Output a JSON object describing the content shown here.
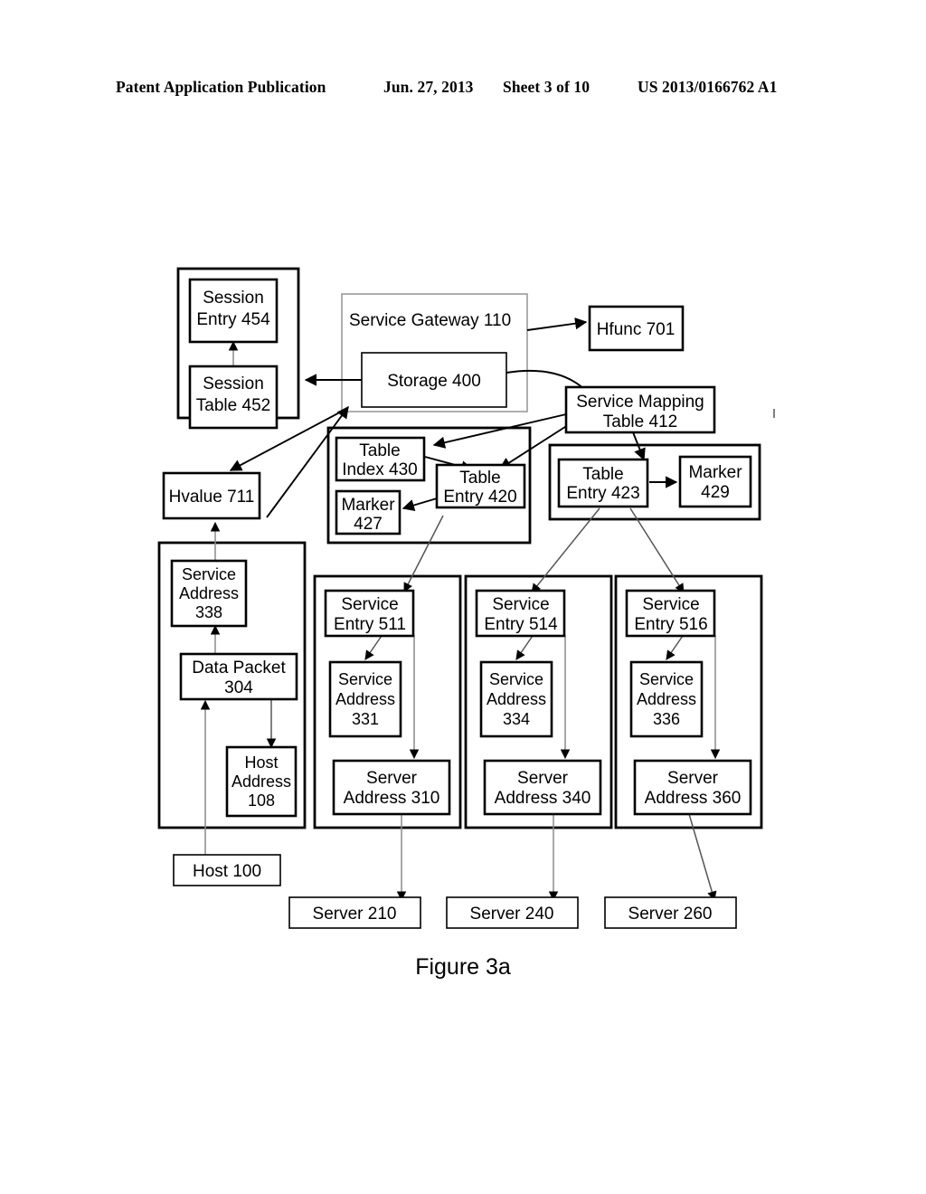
{
  "header": {
    "publication": "Patent Application Publication",
    "date": "Jun. 27, 2013",
    "sheet": "Sheet 3 of 10",
    "number": "US 2013/0166762 A1"
  },
  "figure": {
    "caption": "Figure 3a"
  },
  "diagram": {
    "boxes": {
      "session_entry_454": "Session\nEntry 454",
      "session_table_452": "Session\nTable 452",
      "service_gateway_110": "Service Gateway 110",
      "storage_400": "Storage 400",
      "hfunc_701": "Hfunc 701",
      "service_mapping_table_412": "Service Mapping\nTable 412",
      "table_index_430": "Table\nIndex 430",
      "marker_427": "Marker\n427",
      "table_entry_420": "Table\nEntry 420",
      "table_entry_423": "Table\nEntry 423",
      "marker_429": "Marker\n429",
      "hvalue_711": "Hvalue 711",
      "service_address_338": "Service\nAddress\n338",
      "data_packet_304": "Data Packet\n304",
      "host_address_108": "Host\nAddress\n108",
      "host_100": "Host 100",
      "service_entry_511": "Service\nEntry 511",
      "service_address_331": "Service\nAddress\n331",
      "server_address_310": "Server\nAddress 310",
      "service_entry_514": "Service\nEntry 514",
      "service_address_334": "Service\nAddress\n334",
      "server_address_340": "Server\nAddress 340",
      "service_entry_516": "Service\nEntry 516",
      "service_address_336": "Service\nAddress\n336",
      "server_address_360": "Server\nAddress 360",
      "server_210": "Server 210",
      "server_240": "Server 240",
      "server_260": "Server 260"
    },
    "labels": {
      "session_entry_454_l1": "Session",
      "session_entry_454_l2": "Entry 454",
      "session_table_452_l1": "Session",
      "session_table_452_l2": "Table 452",
      "service_gateway_110_l1": "Service Gateway 110",
      "storage_400_l1": "Storage 400",
      "hfunc_701_l1": "Hfunc 701",
      "smt_412_l1": "Service Mapping",
      "smt_412_l2": "Table 412",
      "table_index_430_l1": "Table",
      "table_index_430_l2": "Index 430",
      "marker_427_l1": "Marker",
      "marker_427_l2": "427",
      "table_entry_420_l1": "Table",
      "table_entry_420_l2": "Entry 420",
      "table_entry_423_l1": "Table",
      "table_entry_423_l2": "Entry 423",
      "marker_429_l1": "Marker",
      "marker_429_l2": "429",
      "hvalue_711_l1": "Hvalue 711",
      "service_address_338_l1": "Service",
      "service_address_338_l2": "Address",
      "service_address_338_l3": "338",
      "data_packet_304_l1": "Data Packet",
      "data_packet_304_l2": "304",
      "host_address_108_l1": "Host",
      "host_address_108_l2": "Address",
      "host_address_108_l3": "108",
      "host_100_l1": "Host 100",
      "service_entry_511_l1": "Service",
      "service_entry_511_l2": "Entry 511",
      "service_address_331_l1": "Service",
      "service_address_331_l2": "Address",
      "service_address_331_l3": "331",
      "server_address_310_l1": "Server",
      "server_address_310_l2": "Address 310",
      "service_entry_514_l1": "Service",
      "service_entry_514_l2": "Entry 514",
      "service_address_334_l1": "Service",
      "service_address_334_l2": "Address",
      "service_address_334_l3": "334",
      "server_address_340_l1": "Server",
      "server_address_340_l2": "Address 340",
      "service_entry_516_l1": "Service",
      "service_entry_516_l2": "Entry 516",
      "service_address_336_l1": "Service",
      "service_address_336_l2": "Address",
      "service_address_336_l3": "336",
      "server_address_360_l1": "Server",
      "server_address_360_l2": "Address 360",
      "server_210_l1": "Server 210",
      "server_240_l1": "Server 240",
      "server_260_l1": "Server 260"
    },
    "colors": {
      "stroke": "#000000",
      "thin_stroke": "#444444",
      "fill": "#ffffff"
    }
  }
}
